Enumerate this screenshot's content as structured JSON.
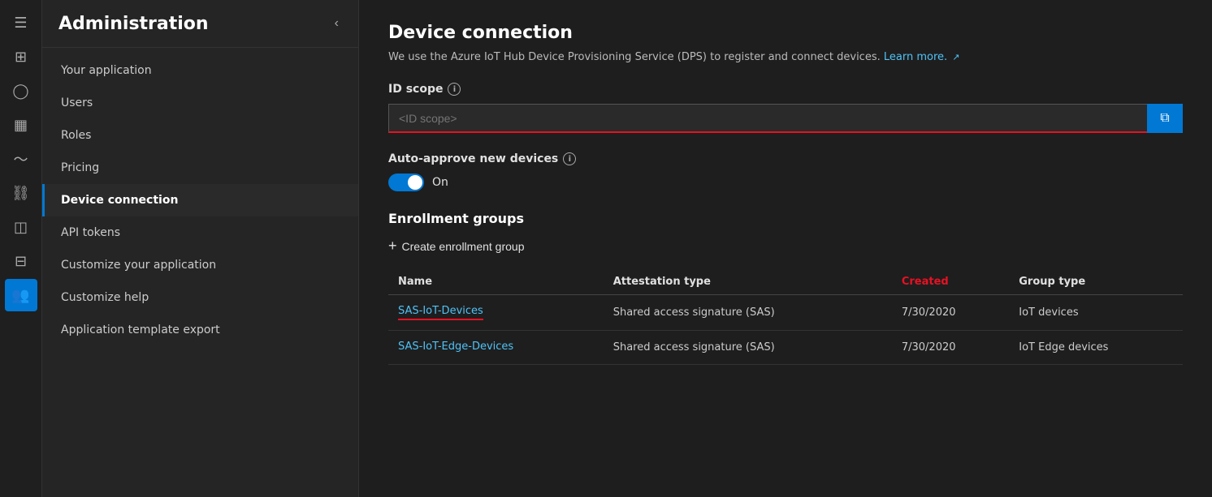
{
  "icon_rail": {
    "items": [
      {
        "name": "hamburger-icon",
        "symbol": "☰",
        "active": false
      },
      {
        "name": "home-icon",
        "symbol": "⊞",
        "active": false
      },
      {
        "name": "user-icon",
        "symbol": "👤",
        "active": false
      },
      {
        "name": "bar-chart-icon",
        "symbol": "📊",
        "active": false
      },
      {
        "name": "analytics-icon",
        "symbol": "📈",
        "active": false
      },
      {
        "name": "device-icon",
        "symbol": "⊡",
        "active": false
      },
      {
        "name": "rules-icon",
        "symbol": "🔧",
        "active": false
      },
      {
        "name": "jobs-icon",
        "symbol": "📋",
        "active": false
      },
      {
        "name": "person-settings-icon",
        "symbol": "👥",
        "active": true
      }
    ]
  },
  "sidebar": {
    "title": "Administration",
    "collapse_btn": "‹",
    "nav_items": [
      {
        "label": "Your application",
        "active": false
      },
      {
        "label": "Users",
        "active": false
      },
      {
        "label": "Roles",
        "active": false
      },
      {
        "label": "Pricing",
        "active": false
      },
      {
        "label": "Device connection",
        "active": true
      },
      {
        "label": "API tokens",
        "active": false
      },
      {
        "label": "Customize your application",
        "active": false
      },
      {
        "label": "Customize help",
        "active": false
      },
      {
        "label": "Application template export",
        "active": false
      }
    ]
  },
  "main": {
    "title": "Device connection",
    "subtitle": "We use the Azure IoT Hub Device Provisioning Service (DPS) to register and connect devices.",
    "learn_more": "Learn more.",
    "id_scope": {
      "label": "ID scope",
      "placeholder": "<ID scope>",
      "copy_icon": "⧉"
    },
    "auto_approve": {
      "label": "Auto-approve new devices",
      "toggle_state": "On"
    },
    "enrollment_groups": {
      "title": "Enrollment groups",
      "create_btn": "Create enrollment group",
      "table": {
        "columns": [
          {
            "label": "Name",
            "key": "name",
            "highlight": false
          },
          {
            "label": "Attestation type",
            "key": "attestation_type",
            "highlight": false
          },
          {
            "label": "Created",
            "key": "created",
            "highlight": true
          },
          {
            "label": "Group type",
            "key": "group_type",
            "highlight": false
          }
        ],
        "rows": [
          {
            "name": "SAS-IoT-Devices",
            "name_link": true,
            "name_underline": true,
            "attestation_type": "Shared access signature (SAS)",
            "created": "7/30/2020",
            "group_type": "IoT devices"
          },
          {
            "name": "SAS-IoT-Edge-Devices",
            "name_link": true,
            "name_underline": false,
            "attestation_type": "Shared access signature (SAS)",
            "created": "7/30/2020",
            "group_type": "IoT Edge devices"
          }
        ]
      }
    }
  }
}
